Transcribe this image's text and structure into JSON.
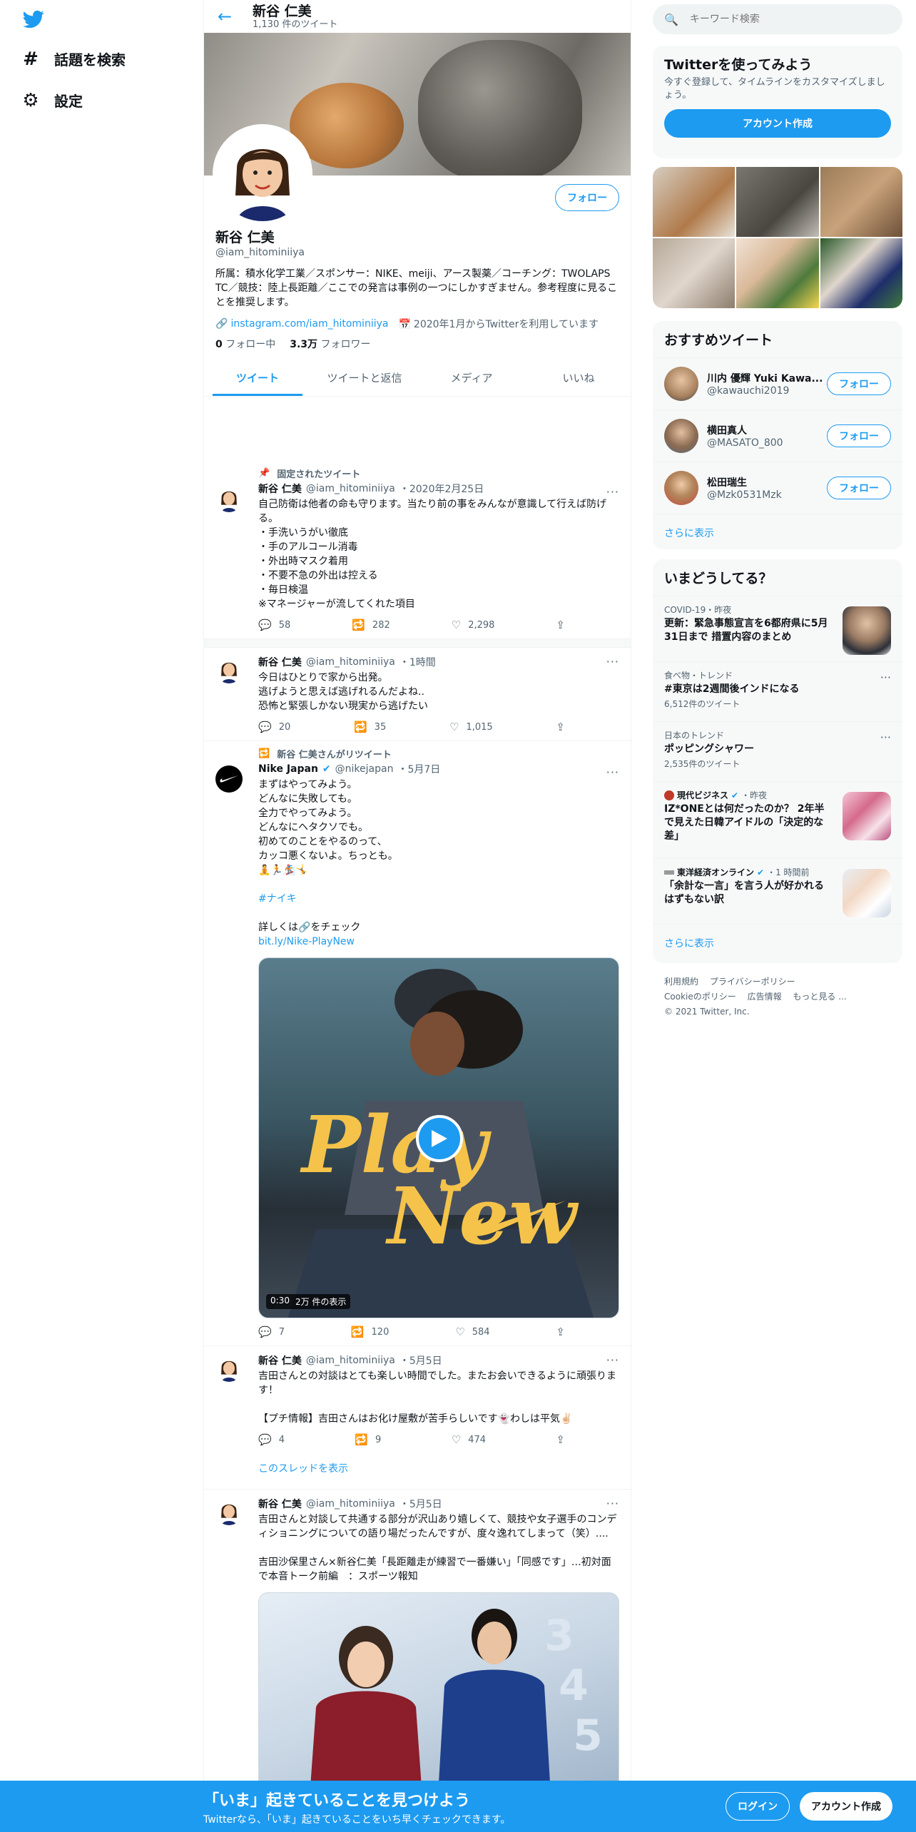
{
  "nav": {
    "explore_label": "話題を検索",
    "settings_label": "設定"
  },
  "header": {
    "name": "新谷 仁美",
    "tweet_count": "1,130 件のツイート"
  },
  "profile": {
    "name": "新谷 仁美",
    "handle": "@iam_hitominiiya",
    "follow_label": "フォロー",
    "bio": "所属：積水化学工業／スポンサー：NIKE、meiji、アース製薬／コーチング：TWOLAPS TC／競技：陸上長距離／ここでの発言は事例の一つにしかすぎません。参考程度に見ることを推奨します。",
    "link": "instagram.com/iam_hitominiiya",
    "joined": "2020年1月からTwitterを利用しています",
    "following_count": "0",
    "following_label": "フォロー中",
    "followers_count": "3.3万",
    "followers_label": "フォロワー"
  },
  "tabs": [
    "ツイート",
    "ツイートと返信",
    "メディア",
    "いいね"
  ],
  "tweets": [
    {
      "context": "固定されたツイート",
      "name": "新谷 仁美",
      "handle": "@iam_hitominiiya",
      "time": "・2020年2月25日",
      "text": "自己防衛は他者の命も守ります。当たり前の事をみんなが意識して行えば防げる。\n・手洗いうがい徹底\n・手のアルコール消毒\n・外出時マスク着用\n・不要不急の外出は控える\n・毎日検温\n※マネージャーが流してくれた項目",
      "replies": "58",
      "retweets": "282",
      "likes": "2,298"
    },
    {
      "name": "新谷 仁美",
      "handle": "@iam_hitominiiya",
      "time": "・1時間",
      "text": "今日はひとりで家から出発。\n逃げようと思えば逃げれるんだよね..\n恐怖と緊張しかない現実から逃げたい",
      "replies": "20",
      "retweets": "35",
      "likes": "1,015"
    },
    {
      "context": "新谷 仁美さんがリツイート",
      "name": "Nike Japan",
      "handle": "@nikejapan",
      "time": "・5月7日",
      "text": "まずはやってみよう。\nどんなに失敗しても。\n全力でやってみよう。\nどんなにヘタクソでも。\n初めてのことをやるのって、\nカッコ悪くないよ。ちっとも。\n🧘🏃🏂🤸",
      "hashtag": "#ナイキ",
      "detail": "詳しくは🔗をチェック",
      "link": "bit.ly/Nike-PlayNew",
      "video_title_line1": "Play",
      "video_title_line2": "New",
      "video_duration": "0:30",
      "video_views": "2万 件の表示",
      "replies": "7",
      "retweets": "120",
      "likes": "584"
    },
    {
      "name": "新谷 仁美",
      "handle": "@iam_hitominiiya",
      "time": "・5月5日",
      "text": "吉田さんとの対談はとても楽しい時間でした。またお会いできるように頑張ります！\n\n【プチ情報】吉田さんはお化け屋敷が苦手らしいです👻わしは平気✌🏻",
      "replies": "4",
      "retweets": "9",
      "likes": "474",
      "thread_label": "このスレッドを表示"
    },
    {
      "name": "新谷 仁美",
      "handle": "@iam_hitominiiya",
      "time": "・5月5日",
      "text": "吉田さんと対談して共通する部分が沢山あり嬉しくて、競技や女子選手のコンディショニングについての語り場だったんですが、度々逸れてしまって（笑）....\n\n吉田沙保里さん×新谷仁美「長距離走が練習で一番嫌い」「同感です」…初対面で本音トーク前編　：スポーツ報知"
    }
  ],
  "search": {
    "placeholder": "キーワード検索"
  },
  "signup_card": {
    "title": "Twitterを使ってみよう",
    "text": "今すぐ登録して、タイムラインをカスタマイズしましょう。",
    "button": "アカウント作成"
  },
  "recommended": {
    "title": "おすすめツイート",
    "users": [
      {
        "name": "川内 優輝 Yuki Kawa...",
        "handle": "@kawauchi2019",
        "button": "フォロー"
      },
      {
        "name": "横田真人",
        "handle": "@MASATO_800",
        "button": "フォロー"
      },
      {
        "name": "松田瑞生",
        "handle": "@Mzk0531Mzk",
        "button": "フォロー"
      }
    ],
    "show_more": "さらに表示"
  },
  "trends": {
    "title": "いまどうしてる？",
    "items": [
      {
        "meta": "COVID-19・昨夜",
        "title": "更新：緊急事態宣言を6都府県に5月31日まで 措置内容のまとめ"
      },
      {
        "meta": "食べ物・トレンド",
        "title": "#東京は2週間後インドになる",
        "count": "6,512件のツイート"
      },
      {
        "meta": "日本のトレンド",
        "title": "ポッピングシャワー",
        "count": "2,535件のツイート"
      },
      {
        "meta_source": "現代ビジネス",
        "meta_time": "・昨夜",
        "title": "IZ*ONEとは何だったのか？ 2年半で見えた日韓アイドルの「決定的な差」"
      },
      {
        "meta_source": "東洋経済オンライン",
        "meta_time": "・1 時間前",
        "title": "「余計な一言」を言う人が好かれるはずもない訳"
      }
    ],
    "show_more": "さらに表示"
  },
  "footer": {
    "terms": "利用規約",
    "privacy": "プライバシーポリシー",
    "cookie": "Cookieのポリシー",
    "ads": "広告情報",
    "more": "もっと見る ...",
    "copyright": "© 2021 Twitter, Inc."
  },
  "bottom_bar": {
    "title": "「いま」起きていることを見つけよう",
    "subtitle": "Twitterなら、「いま」起きていることをいち早くチェックできます。",
    "login": "ログイン",
    "signup": "アカウント作成"
  },
  "colors": {
    "accent": "#1d9bf0",
    "text": "#0f1419",
    "muted": "#536471"
  }
}
